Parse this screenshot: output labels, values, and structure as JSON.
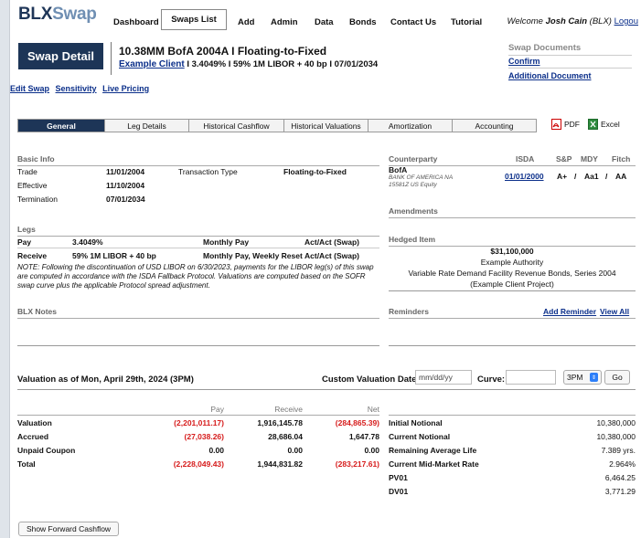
{
  "brand": {
    "bold": "BLX",
    "light": "Swap"
  },
  "nav": {
    "items": [
      "Dashboard",
      "Swaps List",
      "Add",
      "Admin",
      "Data",
      "Bonds",
      "Contact Us",
      "Tutorial"
    ],
    "welcome_prefix": "Welcome ",
    "user": "Josh Cain",
    "org": " (BLX) ",
    "logout": "Logou"
  },
  "detail": {
    "button": "Swap Detail",
    "title": "10.38MM BofA 2004A  I  Floating-to-Fixed",
    "client_link": "Example Client",
    "subtitle_rest": "  I   3.4049%  I   59% 1M LIBOR + 40 bp  I   07/01/2034"
  },
  "documents": {
    "title": "Swap Documents",
    "links": [
      "Confirm",
      "Additional Document"
    ]
  },
  "sublinks": [
    "Edit Swap",
    "Sensitivity",
    "Live Pricing"
  ],
  "tabs": [
    "General",
    "Leg Details",
    "Historical Cashflow",
    "Historical Valuations",
    "Amortization",
    "Accounting"
  ],
  "exports": {
    "pdf": "PDF",
    "excel": "Excel"
  },
  "basic_info": {
    "header": "Basic Info",
    "rows": [
      {
        "label": "Trade",
        "value": "11/01/2004"
      },
      {
        "label": "Effective",
        "value": "11/10/2004"
      },
      {
        "label": "Termination",
        "value": "07/01/2034"
      }
    ],
    "tx_label": "Transaction Type",
    "tx_value": "Floating-to-Fixed"
  },
  "legs": {
    "header": "Legs",
    "rows": [
      {
        "side": "Pay",
        "rate": "3.4049%",
        "freq": "Monthly Pay",
        "basis": "Act/Act (Swap)"
      },
      {
        "side": "Receive",
        "rate": "59% 1M LIBOR + 40 bp",
        "freq": "Monthly Pay, Weekly Reset",
        "basis": "Act/Act (Swap)"
      }
    ],
    "note": "NOTE: Following the discontinuation of USD LIBOR on 6/30/2023, payments for the LIBOR leg(s) of this swap are computed in accordance with the ISDA Fallback Protocol. Valuations are computed based on the SOFR swap curve plus the applicable Protocol spread adjustment."
  },
  "notes": {
    "header": "BLX Notes"
  },
  "counterparty": {
    "header": "Counterparty",
    "cols": [
      "ISDA",
      "S&P",
      "MDY",
      "Fitch"
    ],
    "name": "BofA",
    "line1": "BANK OF AMERICA NA",
    "line2": "15581Z US Equity",
    "isda": "01/01/2000",
    "sp": "A+",
    "sep": "/",
    "mdy": "Aa1",
    "fitch": "AA"
  },
  "amendments": {
    "header": "Amendments"
  },
  "hedged": {
    "header": "Hedged Item",
    "amount": "$31,100,000",
    "issuer": "Example Authority",
    "desc": "Variable Rate Demand Facility Revenue Bonds, Series 2004",
    "project": "(Example Client Project)"
  },
  "reminders": {
    "header": "Reminders",
    "add": "Add Reminder",
    "view": "View All"
  },
  "valuation": {
    "title": "Valuation as of Mon, April 29th, 2024 (3PM)",
    "custom_label": "Custom Valuation Date:",
    "date_placeholder": "mm/dd/yy",
    "curve_label": "Curve:",
    "time": "3PM",
    "go": "Go",
    "cols": [
      "Pay",
      "Receive",
      "Net"
    ],
    "rows": [
      {
        "label": "Valuation",
        "pay": "(2,201,011.17)",
        "receive": "1,916,145.78",
        "net": "(284,865.39)"
      },
      {
        "label": "Accrued",
        "pay": "(27,038.26)",
        "receive": "28,686.04",
        "net": "1,647.78"
      },
      {
        "label": "Unpaid Coupon",
        "pay": "0.00",
        "receive": "0.00",
        "net": "0.00"
      },
      {
        "label": "Total",
        "pay": "(2,228,049.43)",
        "receive": "1,944,831.82",
        "net": "(283,217.61)"
      }
    ],
    "metrics": [
      {
        "label": "Initial Notional",
        "value": "10,380,000"
      },
      {
        "label": "Current Notional",
        "value": "10,380,000"
      },
      {
        "label": "Remaining Average Life",
        "value": "7.389 yrs."
      },
      {
        "label": "Current Mid-Market Rate",
        "value": "2.964%"
      },
      {
        "label": "PV01",
        "value": "6,464.25"
      },
      {
        "label": "DV01",
        "value": "3,771.29"
      }
    ]
  },
  "forward_button": "Show Forward Cashflow",
  "colors": {
    "navy": "#1d3557",
    "link": "#0b2f8a",
    "negative": "#d61b1b"
  }
}
